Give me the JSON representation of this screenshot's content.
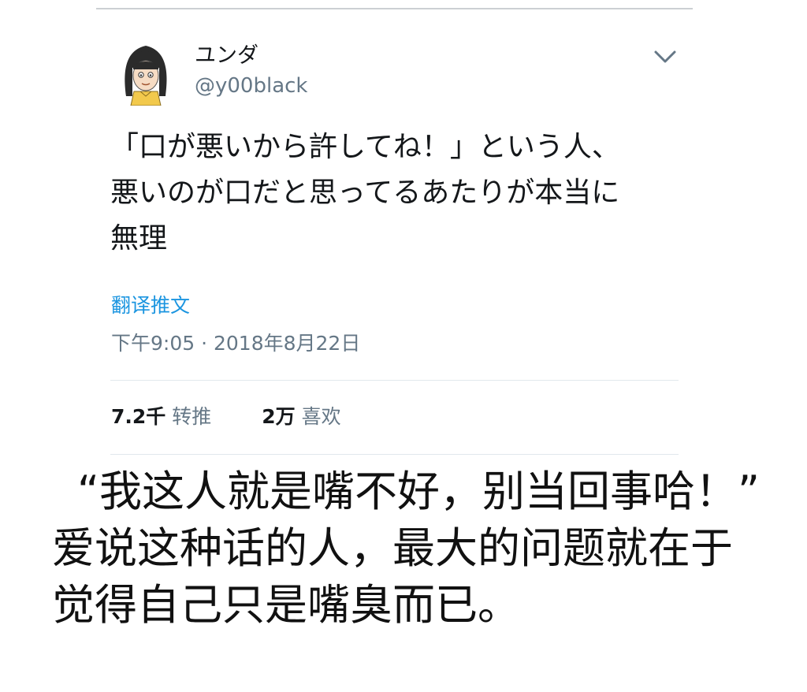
{
  "tweet": {
    "author": {
      "display_name": "ユンダ",
      "handle": "@y00black",
      "avatar_icon": "cartoon-girl-avatar-icon"
    },
    "menu_icon": "chevron-down-icon",
    "text_lines": [
      "「口が悪いから許してね！」という人、",
      "悪いのが口だと思ってるあたりが本当に",
      "無理"
    ],
    "translate_label": "翻译推文",
    "timestamp": "下午9:05 · 2018年8月22日",
    "stats": {
      "retweets": {
        "count": "7.2千",
        "label": "转推"
      },
      "likes": {
        "count": "2万",
        "label": "喜欢"
      }
    }
  },
  "caption": {
    "lines": [
      "“我这人就是嘴不好，别当回事哈！”",
      "爱说这种话的人，最大的问题就在于",
      "觉得自己只是嘴臭而已。"
    ]
  },
  "colors": {
    "text_primary": "#14171a",
    "text_secondary": "#657786",
    "link_blue": "#1b95e0",
    "divider": "#e1e8ed"
  }
}
